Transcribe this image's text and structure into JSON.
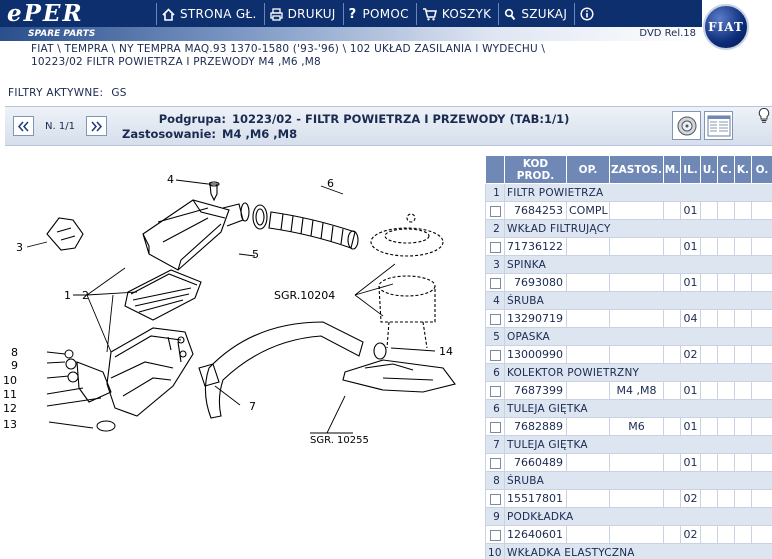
{
  "header": {
    "logo": "ePER",
    "spare_parts": "SPARE PARTS",
    "version": "DVD Rel.18",
    "nav": [
      {
        "label": "STRONA GŁ.",
        "icon": "home-icon"
      },
      {
        "label": "DRUKUJ",
        "icon": "print-icon"
      },
      {
        "label": "POMOC",
        "icon": "help-icon"
      },
      {
        "label": "KOSZYK",
        "icon": "cart-icon"
      },
      {
        "label": "SZUKAJ",
        "icon": "search-icon"
      },
      {
        "label": "",
        "icon": "info-icon"
      }
    ],
    "brand": "FIAT"
  },
  "breadcrumb": {
    "line1": "FIAT \\ TEMPRA \\ NY TEMPRA MAQ.93 1370-1580 ('93-'96) \\ 102 UKŁAD ZASILANIA I WYDECHU \\",
    "line2": "10223/02 FILTR POWIETRZA I PRZEWODY M4 ,M6 ,M8"
  },
  "filters": {
    "label": "FILTRY AKTYWNE:",
    "value": "GS"
  },
  "infobar": {
    "page": "N. 1/1",
    "subgroup_label": "Podgrupa:",
    "subgroup_value": "10223/02 - FILTR POWIETRZA I PRZEWODY (TAB:1/1)",
    "usage_label": "Zastosowanie:",
    "usage_value": "M4 ,M6 ,M8"
  },
  "drawing": {
    "callouts": [
      "1",
      "2",
      "3",
      "4",
      "5",
      "6",
      "7",
      "8",
      "9",
      "10",
      "11",
      "12",
      "13",
      "14"
    ],
    "ref_a": "SGR.10204",
    "ref_b": "SGR. 10255"
  },
  "table": {
    "headers": [
      "KOD PROD.",
      "OP.",
      "ZASTOS.",
      "M.",
      "IL.",
      "U.",
      "C.",
      "K.",
      "O."
    ],
    "groups": [
      {
        "num": "1",
        "name": "FILTR POWIETRZA",
        "code": "7684253",
        "op": "COMPL",
        "zastos": "",
        "qty": "01"
      },
      {
        "num": "2",
        "name": "WKŁAD FILTRUJĄCY",
        "code": "71736122",
        "op": "",
        "zastos": "",
        "qty": "01"
      },
      {
        "num": "3",
        "name": "SPINKA",
        "code": "7693080",
        "op": "",
        "zastos": "",
        "qty": "01"
      },
      {
        "num": "4",
        "name": "ŚRUBA",
        "code": "13290719",
        "op": "",
        "zastos": "",
        "qty": "04"
      },
      {
        "num": "5",
        "name": "OPASKA",
        "code": "13000990",
        "op": "",
        "zastos": "",
        "qty": "02"
      },
      {
        "num": "6",
        "name": "KOLEKTOR POWIETRZNY",
        "code": "7687399",
        "op": "",
        "zastos": "M4 ,M8",
        "qty": "01"
      },
      {
        "num": "6",
        "name": "TULEJA GIĘTKA",
        "code": "7682889",
        "op": "",
        "zastos": "M6",
        "qty": "01"
      },
      {
        "num": "7",
        "name": "TULEJA GIĘTKA",
        "code": "7660489",
        "op": "",
        "zastos": "",
        "qty": "01"
      },
      {
        "num": "8",
        "name": "ŚRUBA",
        "code": "15517801",
        "op": "",
        "zastos": "",
        "qty": "02"
      },
      {
        "num": "9",
        "name": "PODKŁADKA",
        "code": "12640601",
        "op": "",
        "zastos": "",
        "qty": "02"
      },
      {
        "num": "10",
        "name": "WKŁADKA ELASTYCZNA",
        "code": "",
        "op": "",
        "zastos": "",
        "qty": ""
      }
    ]
  }
}
